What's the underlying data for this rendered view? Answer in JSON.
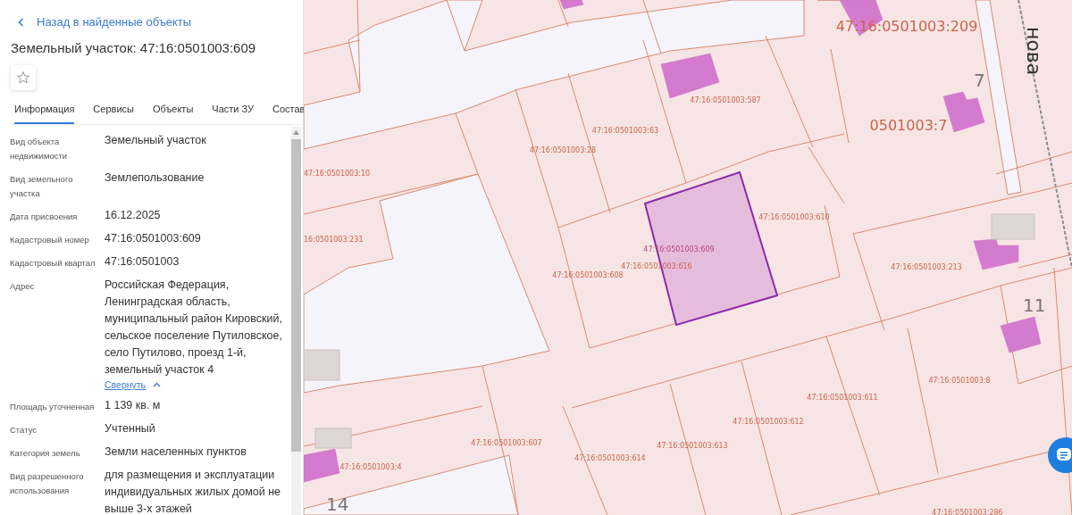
{
  "panel": {
    "back_link": "Назад в найденные объекты",
    "title": "Земельный участок: 47:16:0501003:609",
    "favorite": {
      "on": false
    },
    "tabs": [
      {
        "label": "Информация",
        "selected": true
      },
      {
        "label": "Сервисы",
        "selected": false
      },
      {
        "label": "Объекты",
        "selected": false
      },
      {
        "label": "Части ЗУ",
        "selected": false
      },
      {
        "label": "Состав",
        "selected": false
      }
    ],
    "fields": [
      {
        "label": "Вид объекта недвижимости",
        "value": "Земельный участок"
      },
      {
        "label": "Вид земельного участка",
        "value": "Землепользование"
      },
      {
        "label": "Дата присвоения",
        "value": "16.12.2025"
      },
      {
        "label": "Кадастровый номер",
        "value": "47:16:0501003:609"
      },
      {
        "label": "Кадастровый квартал",
        "value": "47:16:0501003"
      },
      {
        "label": "Адрес",
        "value": "Российская Федерация, Ленинградская область, муниципальный район Кировский, сельское поселение Путиловское, село Путилово, проезд 1-й, земельный участок 4",
        "toggle": {
          "label": "Свернуть",
          "expanded": true
        }
      },
      {
        "label": "Площадь уточненная",
        "value": "1 139 кв. м"
      },
      {
        "label": "Статус",
        "value": "Учтенный"
      },
      {
        "label": "Категория земель",
        "value": "Земли населенных пунктов"
      },
      {
        "label": "Вид разрешенного использования",
        "value": "для размещения и эксплуатации индивидуальных жилых домой не выше 3-х этажей"
      }
    ]
  },
  "map": {
    "parcel_labels": [
      {
        "text": "47:16:0501003:209",
        "selected": false
      },
      {
        "text": "47:16:0501003:587",
        "selected": false
      },
      {
        "text": "47:16:0501003:63",
        "selected": false
      },
      {
        "text": "47:16:0501003:28",
        "selected": false
      },
      {
        "text": "47:16:0501003:10",
        "selected": false
      },
      {
        "text": "0501003:7",
        "selected": false
      },
      {
        "text": "47:16:0501003:610",
        "selected": false
      },
      {
        "text": "16:0501003:231",
        "selected": false
      },
      {
        "text": "47:16:0501003:609",
        "selected": true
      },
      {
        "text": "47:16:0501003:616",
        "selected": false
      },
      {
        "text": "47:16:0501003:608",
        "selected": false
      },
      {
        "text": "47:16:0501003:213",
        "selected": false
      },
      {
        "text": "47:16:0501003:8",
        "selected": false
      },
      {
        "text": "47:16:0501003:611",
        "selected": false
      },
      {
        "text": "47:16:0501003:612",
        "selected": false
      },
      {
        "text": "47:16:0501003:613",
        "selected": false
      },
      {
        "text": "47:16:0501003:614",
        "selected": false
      },
      {
        "text": "47:16:0501003:607",
        "selected": false
      },
      {
        "text": "47:16:0501003:4",
        "selected": false
      },
      {
        "text": "47:16:0501003:286",
        "selected": false
      }
    ],
    "house_numbers": [
      "7",
      "11",
      "14"
    ],
    "street_label": "нова"
  }
}
